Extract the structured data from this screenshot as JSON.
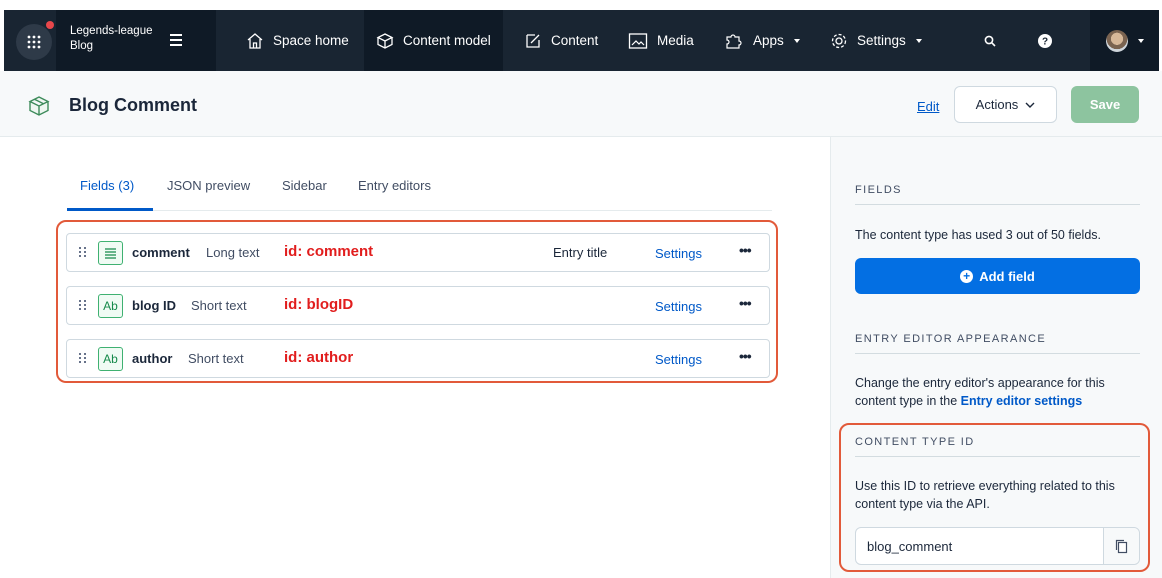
{
  "topnav": {
    "space_name": "Legends-league",
    "environment": "Blog",
    "items": [
      {
        "label": "Space home",
        "icon": "home-icon"
      },
      {
        "label": "Content model",
        "icon": "content-model-icon"
      },
      {
        "label": "Content",
        "icon": "edit-icon"
      },
      {
        "label": "Media",
        "icon": "image-icon"
      },
      {
        "label": "Apps",
        "icon": "puzzle-icon"
      },
      {
        "label": "Settings",
        "icon": "gear-icon"
      }
    ]
  },
  "header": {
    "title": "Blog Comment",
    "edit_label": "Edit",
    "actions_label": "Actions",
    "save_label": "Save"
  },
  "tabs": [
    "Fields (3)",
    "JSON preview",
    "Sidebar",
    "Entry editors"
  ],
  "fields": [
    {
      "name": "comment",
      "type": "Long text",
      "id_label": "id: comment",
      "entry_title": "Entry title",
      "settings": "Settings",
      "more": "•••",
      "icon": "long-text-icon"
    },
    {
      "name": "blog ID",
      "type": "Short text",
      "id_label": "id: blogID",
      "entry_title": "",
      "settings": "Settings",
      "more": "•••",
      "icon": "short-text-icon",
      "icon_text": "Ab"
    },
    {
      "name": "author",
      "type": "Short text",
      "id_label": "id: author",
      "entry_title": "",
      "settings": "Settings",
      "more": "•••",
      "icon": "short-text-icon",
      "icon_text": "Ab"
    }
  ],
  "sidebar": {
    "fields_heading": "FIELDS",
    "fields_text": "The content type has used 3 out of 50 fields.",
    "add_field_label": "Add field",
    "appearance_heading": "ENTRY EDITOR APPEARANCE",
    "appearance_text": "Change the entry editor's appearance for this content type in the ",
    "appearance_link": "Entry editor settings",
    "ctid_heading": "CONTENT TYPE ID",
    "ctid_text": "Use this ID to retrieve everything related to this content type via the API.",
    "ctid_value": "blog_comment"
  },
  "colors": {
    "nav_bg": "#192532",
    "primary": "#036fe3",
    "link": "#0059c8",
    "save_disabled": "#8dc49f",
    "annotation_red": "#e11d1d"
  }
}
